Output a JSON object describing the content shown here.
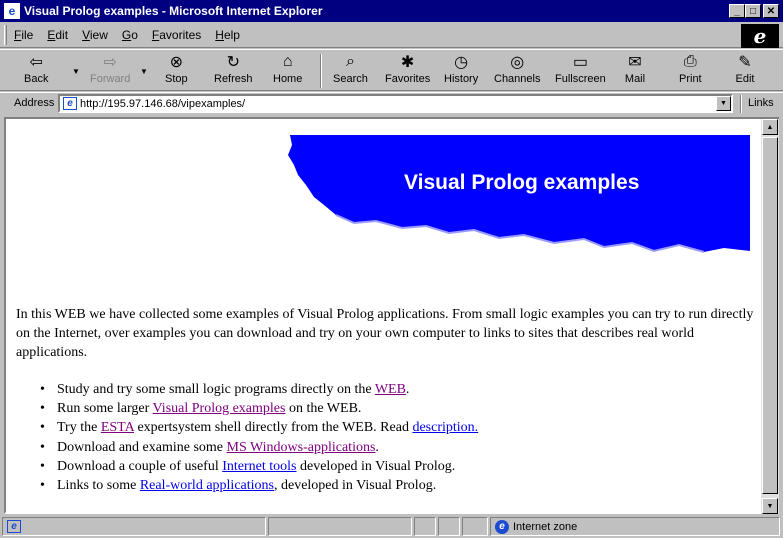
{
  "window": {
    "title": "Visual Prolog examples - Microsoft Internet Explorer"
  },
  "menu": [
    "File",
    "Edit",
    "View",
    "Go",
    "Favorites",
    "Help"
  ],
  "toolbar": [
    {
      "label": "Back",
      "icon": "back-icon"
    },
    {
      "label": "Forward",
      "icon": "forward-icon"
    },
    {
      "label": "Stop",
      "icon": "stop-icon"
    },
    {
      "label": "Refresh",
      "icon": "refresh-icon"
    },
    {
      "label": "Home",
      "icon": "home-icon"
    },
    {
      "label": "Search",
      "icon": "search-icon"
    },
    {
      "label": "Favorites",
      "icon": "favorites-icon"
    },
    {
      "label": "History",
      "icon": "history-icon"
    },
    {
      "label": "Channels",
      "icon": "channels-icon"
    },
    {
      "label": "Fullscreen",
      "icon": "fullscreen-icon"
    },
    {
      "label": "Mail",
      "icon": "mail-icon"
    },
    {
      "label": "Print",
      "icon": "print-icon"
    },
    {
      "label": "Edit",
      "icon": "edit-icon"
    }
  ],
  "address": {
    "label": "Address",
    "url": "http://195.97.146.68/vipexamples/",
    "links_label": "Links"
  },
  "page": {
    "banner_title": "Visual Prolog examples",
    "intro": "In this WEB we have collected some examples of Visual Prolog applications. From small logic examples you can try to run directly on the Internet, over examples you can download and try on your own computer to links to sites that describes real world applications.",
    "bullets": [
      {
        "before": "Study and try some small logic programs directly on the ",
        "link": "WEB",
        "after": "."
      },
      {
        "before": "Run some larger ",
        "link": "Visual Prolog examples",
        "after": " on the WEB."
      },
      {
        "before": "Try the ",
        "link": "ESTA",
        "after": " expertsystem shell directly from the WEB. Read ",
        "link2": "description."
      },
      {
        "before": "Download and examine some ",
        "link": "MS Windows-applications",
        "after": "."
      },
      {
        "before": "Download a couple of useful ",
        "link": "Internet tools",
        "after": " developed in Visual Prolog."
      },
      {
        "before": "Links to some ",
        "link": "Real-world applications",
        "after": ", developed in Visual Prolog."
      }
    ]
  },
  "status": {
    "zone": "Internet zone"
  },
  "colors": {
    "titlebar": "#000080",
    "banner": "#0000ff",
    "link": "#0000ee",
    "visited_link": "#800080"
  }
}
